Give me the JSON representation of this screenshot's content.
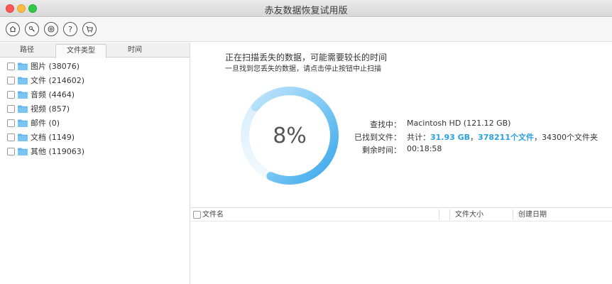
{
  "window": {
    "title": "赤友数据恢复试用版"
  },
  "toolbar": {
    "buttons": [
      {
        "icon": "home-icon"
      },
      {
        "icon": "key-icon"
      },
      {
        "icon": "lifebuoy-icon"
      },
      {
        "icon": "help-icon",
        "glyph": "?"
      },
      {
        "icon": "cart-icon"
      }
    ]
  },
  "left": {
    "tabs": [
      {
        "label": "路径"
      },
      {
        "label": "文件类型",
        "active": true
      },
      {
        "label": "时间"
      }
    ],
    "tree": [
      {
        "label": "图片 (38076)"
      },
      {
        "label": "文件 (214602)"
      },
      {
        "label": "音频 (4464)"
      },
      {
        "label": "视频 (857)"
      },
      {
        "label": "邮件 (0)"
      },
      {
        "label": "文档 (1149)"
      },
      {
        "label": "其他 (119063)"
      }
    ]
  },
  "scan": {
    "title": "正在扫描丢失的数据，可能需要较长的时间",
    "subtitle": "一旦找到您丢失的数据，请点击停止按钮中止扫描",
    "progress_text": "8%",
    "progress": 0.08,
    "searching_label": "查找中：",
    "searching_value": "Macintosh HD (121.12 GB)",
    "found_label": "已找到文件：",
    "found_prefix": "共计：",
    "found_size": "31.93 GB",
    "found_sep": "，",
    "found_files": "378211个文件",
    "found_folders": "，34300个文件夹",
    "remaining_label": "剩余时间：",
    "remaining_value": "00:18:58",
    "ring_color": "#4fb3ee"
  },
  "list": {
    "columns": [
      {
        "label": "文件名"
      },
      {
        "label": "文件大小"
      },
      {
        "label": "创建日期"
      }
    ]
  }
}
